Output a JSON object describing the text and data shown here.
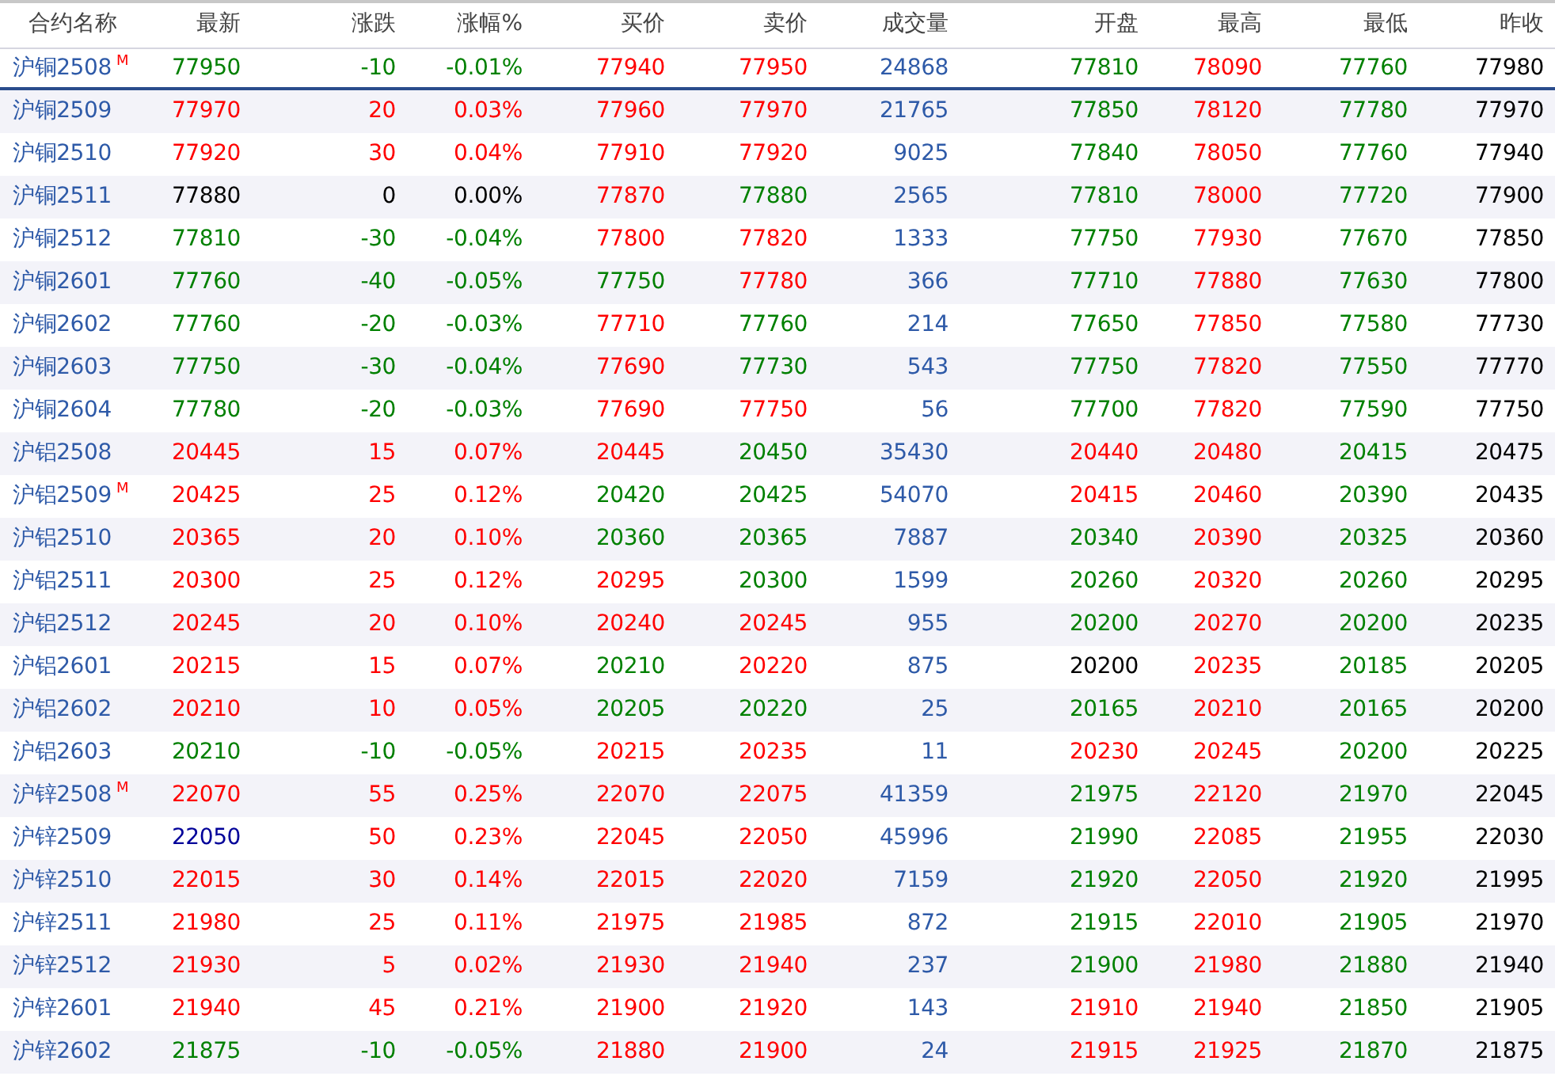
{
  "columns": [
    "合约名称",
    "最新",
    "涨跌",
    "涨幅%",
    "买价",
    "卖价",
    "成交量",
    "开盘",
    "最高",
    "最低",
    "昨收"
  ],
  "rows": [
    {
      "name": "沪铜2508",
      "mark": "M",
      "selected": true,
      "cells": [
        {
          "text": "77950",
          "color": "#008000"
        },
        {
          "text": "-10",
          "color": "#008000"
        },
        {
          "text": "-0.01%",
          "color": "#008000"
        },
        {
          "text": "77940",
          "color": "#ff0000"
        },
        {
          "text": "77950",
          "color": "#ff0000"
        },
        {
          "text": "24868",
          "color": "#2e5aa8"
        },
        {
          "text": "77810",
          "color": "#008000"
        },
        {
          "text": "78090",
          "color": "#ff0000"
        },
        {
          "text": "77760",
          "color": "#008000"
        },
        {
          "text": "77980",
          "color": "#000000"
        }
      ]
    },
    {
      "name": "沪铜2509",
      "selected": false,
      "cells": [
        {
          "text": "77970",
          "color": "#ff0000"
        },
        {
          "text": "20",
          "color": "#ff0000"
        },
        {
          "text": "0.03%",
          "color": "#ff0000"
        },
        {
          "text": "77960",
          "color": "#ff0000"
        },
        {
          "text": "77970",
          "color": "#ff0000"
        },
        {
          "text": "21765",
          "color": "#2e5aa8"
        },
        {
          "text": "77850",
          "color": "#008000"
        },
        {
          "text": "78120",
          "color": "#ff0000"
        },
        {
          "text": "77780",
          "color": "#008000"
        },
        {
          "text": "77970",
          "color": "#000000"
        }
      ]
    },
    {
      "name": "沪铜2510",
      "selected": false,
      "cells": [
        {
          "text": "77920",
          "color": "#ff0000"
        },
        {
          "text": "30",
          "color": "#ff0000"
        },
        {
          "text": "0.04%",
          "color": "#ff0000"
        },
        {
          "text": "77910",
          "color": "#ff0000"
        },
        {
          "text": "77920",
          "color": "#ff0000"
        },
        {
          "text": "9025",
          "color": "#2e5aa8"
        },
        {
          "text": "77840",
          "color": "#008000"
        },
        {
          "text": "78050",
          "color": "#ff0000"
        },
        {
          "text": "77760",
          "color": "#008000"
        },
        {
          "text": "77940",
          "color": "#000000"
        }
      ]
    },
    {
      "name": "沪铜2511",
      "selected": false,
      "cells": [
        {
          "text": "77880",
          "color": "#000000"
        },
        {
          "text": "0",
          "color": "#000000"
        },
        {
          "text": "0.00%",
          "color": "#000000"
        },
        {
          "text": "77870",
          "color": "#ff0000"
        },
        {
          "text": "77880",
          "color": "#008000"
        },
        {
          "text": "2565",
          "color": "#2e5aa8"
        },
        {
          "text": "77810",
          "color": "#008000"
        },
        {
          "text": "78000",
          "color": "#ff0000"
        },
        {
          "text": "77720",
          "color": "#008000"
        },
        {
          "text": "77900",
          "color": "#000000"
        }
      ]
    },
    {
      "name": "沪铜2512",
      "selected": false,
      "cells": [
        {
          "text": "77810",
          "color": "#008000"
        },
        {
          "text": "-30",
          "color": "#008000"
        },
        {
          "text": "-0.04%",
          "color": "#008000"
        },
        {
          "text": "77800",
          "color": "#ff0000"
        },
        {
          "text": "77820",
          "color": "#ff0000"
        },
        {
          "text": "1333",
          "color": "#2e5aa8"
        },
        {
          "text": "77750",
          "color": "#008000"
        },
        {
          "text": "77930",
          "color": "#ff0000"
        },
        {
          "text": "77670",
          "color": "#008000"
        },
        {
          "text": "77850",
          "color": "#000000"
        }
      ]
    },
    {
      "name": "沪铜2601",
      "selected": false,
      "cells": [
        {
          "text": "77760",
          "color": "#008000"
        },
        {
          "text": "-40",
          "color": "#008000"
        },
        {
          "text": "-0.05%",
          "color": "#008000"
        },
        {
          "text": "77750",
          "color": "#008000"
        },
        {
          "text": "77780",
          "color": "#ff0000"
        },
        {
          "text": "366",
          "color": "#2e5aa8"
        },
        {
          "text": "77710",
          "color": "#008000"
        },
        {
          "text": "77880",
          "color": "#ff0000"
        },
        {
          "text": "77630",
          "color": "#008000"
        },
        {
          "text": "77800",
          "color": "#000000"
        }
      ]
    },
    {
      "name": "沪铜2602",
      "selected": false,
      "cells": [
        {
          "text": "77760",
          "color": "#008000"
        },
        {
          "text": "-20",
          "color": "#008000"
        },
        {
          "text": "-0.03%",
          "color": "#008000"
        },
        {
          "text": "77710",
          "color": "#ff0000"
        },
        {
          "text": "77760",
          "color": "#008000"
        },
        {
          "text": "214",
          "color": "#2e5aa8"
        },
        {
          "text": "77650",
          "color": "#008000"
        },
        {
          "text": "77850",
          "color": "#ff0000"
        },
        {
          "text": "77580",
          "color": "#008000"
        },
        {
          "text": "77730",
          "color": "#000000"
        }
      ]
    },
    {
      "name": "沪铜2603",
      "selected": false,
      "cells": [
        {
          "text": "77750",
          "color": "#008000"
        },
        {
          "text": "-30",
          "color": "#008000"
        },
        {
          "text": "-0.04%",
          "color": "#008000"
        },
        {
          "text": "77690",
          "color": "#ff0000"
        },
        {
          "text": "77730",
          "color": "#008000"
        },
        {
          "text": "543",
          "color": "#2e5aa8"
        },
        {
          "text": "77750",
          "color": "#008000"
        },
        {
          "text": "77820",
          "color": "#ff0000"
        },
        {
          "text": "77550",
          "color": "#008000"
        },
        {
          "text": "77770",
          "color": "#000000"
        }
      ]
    },
    {
      "name": "沪铜2604",
      "selected": false,
      "cells": [
        {
          "text": "77780",
          "color": "#008000"
        },
        {
          "text": "-20",
          "color": "#008000"
        },
        {
          "text": "-0.03%",
          "color": "#008000"
        },
        {
          "text": "77690",
          "color": "#ff0000"
        },
        {
          "text": "77750",
          "color": "#ff0000"
        },
        {
          "text": "56",
          "color": "#2e5aa8"
        },
        {
          "text": "77700",
          "color": "#008000"
        },
        {
          "text": "77820",
          "color": "#ff0000"
        },
        {
          "text": "77590",
          "color": "#008000"
        },
        {
          "text": "77750",
          "color": "#000000"
        }
      ]
    },
    {
      "name": "沪铝2508",
      "selected": false,
      "cells": [
        {
          "text": "20445",
          "color": "#ff0000"
        },
        {
          "text": "15",
          "color": "#ff0000"
        },
        {
          "text": "0.07%",
          "color": "#ff0000"
        },
        {
          "text": "20445",
          "color": "#ff0000"
        },
        {
          "text": "20450",
          "color": "#008000"
        },
        {
          "text": "35430",
          "color": "#2e5aa8"
        },
        {
          "text": "20440",
          "color": "#ff0000"
        },
        {
          "text": "20480",
          "color": "#ff0000"
        },
        {
          "text": "20415",
          "color": "#008000"
        },
        {
          "text": "20475",
          "color": "#000000"
        }
      ]
    },
    {
      "name": "沪铝2509",
      "mark": "M",
      "selected": false,
      "cells": [
        {
          "text": "20425",
          "color": "#ff0000"
        },
        {
          "text": "25",
          "color": "#ff0000"
        },
        {
          "text": "0.12%",
          "color": "#ff0000"
        },
        {
          "text": "20420",
          "color": "#008000"
        },
        {
          "text": "20425",
          "color": "#008000"
        },
        {
          "text": "54070",
          "color": "#2e5aa8"
        },
        {
          "text": "20415",
          "color": "#ff0000"
        },
        {
          "text": "20460",
          "color": "#ff0000"
        },
        {
          "text": "20390",
          "color": "#008000"
        },
        {
          "text": "20435",
          "color": "#000000"
        }
      ]
    },
    {
      "name": "沪铝2510",
      "selected": false,
      "cells": [
        {
          "text": "20365",
          "color": "#ff0000"
        },
        {
          "text": "20",
          "color": "#ff0000"
        },
        {
          "text": "0.10%",
          "color": "#ff0000"
        },
        {
          "text": "20360",
          "color": "#008000"
        },
        {
          "text": "20365",
          "color": "#008000"
        },
        {
          "text": "7887",
          "color": "#2e5aa8"
        },
        {
          "text": "20340",
          "color": "#008000"
        },
        {
          "text": "20390",
          "color": "#ff0000"
        },
        {
          "text": "20325",
          "color": "#008000"
        },
        {
          "text": "20360",
          "color": "#000000"
        }
      ]
    },
    {
      "name": "沪铝2511",
      "selected": false,
      "cells": [
        {
          "text": "20300",
          "color": "#ff0000"
        },
        {
          "text": "25",
          "color": "#ff0000"
        },
        {
          "text": "0.12%",
          "color": "#ff0000"
        },
        {
          "text": "20295",
          "color": "#ff0000"
        },
        {
          "text": "20300",
          "color": "#008000"
        },
        {
          "text": "1599",
          "color": "#2e5aa8"
        },
        {
          "text": "20260",
          "color": "#008000"
        },
        {
          "text": "20320",
          "color": "#ff0000"
        },
        {
          "text": "20260",
          "color": "#008000"
        },
        {
          "text": "20295",
          "color": "#000000"
        }
      ]
    },
    {
      "name": "沪铝2512",
      "selected": false,
      "cells": [
        {
          "text": "20245",
          "color": "#ff0000"
        },
        {
          "text": "20",
          "color": "#ff0000"
        },
        {
          "text": "0.10%",
          "color": "#ff0000"
        },
        {
          "text": "20240",
          "color": "#ff0000"
        },
        {
          "text": "20245",
          "color": "#ff0000"
        },
        {
          "text": "955",
          "color": "#2e5aa8"
        },
        {
          "text": "20200",
          "color": "#008000"
        },
        {
          "text": "20270",
          "color": "#ff0000"
        },
        {
          "text": "20200",
          "color": "#008000"
        },
        {
          "text": "20235",
          "color": "#000000"
        }
      ]
    },
    {
      "name": "沪铝2601",
      "selected": false,
      "cells": [
        {
          "text": "20215",
          "color": "#ff0000"
        },
        {
          "text": "15",
          "color": "#ff0000"
        },
        {
          "text": "0.07%",
          "color": "#ff0000"
        },
        {
          "text": "20210",
          "color": "#008000"
        },
        {
          "text": "20220",
          "color": "#ff0000"
        },
        {
          "text": "875",
          "color": "#2e5aa8"
        },
        {
          "text": "20200",
          "color": "#000000"
        },
        {
          "text": "20235",
          "color": "#ff0000"
        },
        {
          "text": "20185",
          "color": "#008000"
        },
        {
          "text": "20205",
          "color": "#000000"
        }
      ]
    },
    {
      "name": "沪铝2602",
      "selected": false,
      "cells": [
        {
          "text": "20210",
          "color": "#ff0000"
        },
        {
          "text": "10",
          "color": "#ff0000"
        },
        {
          "text": "0.05%",
          "color": "#ff0000"
        },
        {
          "text": "20205",
          "color": "#008000"
        },
        {
          "text": "20220",
          "color": "#008000"
        },
        {
          "text": "25",
          "color": "#2e5aa8"
        },
        {
          "text": "20165",
          "color": "#008000"
        },
        {
          "text": "20210",
          "color": "#ff0000"
        },
        {
          "text": "20165",
          "color": "#008000"
        },
        {
          "text": "20200",
          "color": "#000000"
        }
      ]
    },
    {
      "name": "沪铝2603",
      "selected": false,
      "cells": [
        {
          "text": "20210",
          "color": "#008000"
        },
        {
          "text": "-10",
          "color": "#008000"
        },
        {
          "text": "-0.05%",
          "color": "#008000"
        },
        {
          "text": "20215",
          "color": "#ff0000"
        },
        {
          "text": "20235",
          "color": "#ff0000"
        },
        {
          "text": "11",
          "color": "#2e5aa8"
        },
        {
          "text": "20230",
          "color": "#ff0000"
        },
        {
          "text": "20245",
          "color": "#ff0000"
        },
        {
          "text": "20200",
          "color": "#008000"
        },
        {
          "text": "20225",
          "color": "#000000"
        }
      ]
    },
    {
      "name": "沪锌2508",
      "mark": "M",
      "selected": false,
      "cells": [
        {
          "text": "22070",
          "color": "#ff0000"
        },
        {
          "text": "55",
          "color": "#ff0000"
        },
        {
          "text": "0.25%",
          "color": "#ff0000"
        },
        {
          "text": "22070",
          "color": "#ff0000"
        },
        {
          "text": "22075",
          "color": "#ff0000"
        },
        {
          "text": "41359",
          "color": "#2e5aa8"
        },
        {
          "text": "21975",
          "color": "#008000"
        },
        {
          "text": "22120",
          "color": "#ff0000"
        },
        {
          "text": "21970",
          "color": "#008000"
        },
        {
          "text": "22045",
          "color": "#000000"
        }
      ]
    },
    {
      "name": "沪锌2509",
      "selected": false,
      "cells": [
        {
          "text": "22050",
          "color": "#000099"
        },
        {
          "text": "50",
          "color": "#ff0000"
        },
        {
          "text": "0.23%",
          "color": "#ff0000"
        },
        {
          "text": "22045",
          "color": "#ff0000"
        },
        {
          "text": "22050",
          "color": "#ff0000"
        },
        {
          "text": "45996",
          "color": "#2e5aa8"
        },
        {
          "text": "21990",
          "color": "#008000"
        },
        {
          "text": "22085",
          "color": "#ff0000"
        },
        {
          "text": "21955",
          "color": "#008000"
        },
        {
          "text": "22030",
          "color": "#000000"
        }
      ]
    },
    {
      "name": "沪锌2510",
      "selected": false,
      "cells": [
        {
          "text": "22015",
          "color": "#ff0000"
        },
        {
          "text": "30",
          "color": "#ff0000"
        },
        {
          "text": "0.14%",
          "color": "#ff0000"
        },
        {
          "text": "22015",
          "color": "#ff0000"
        },
        {
          "text": "22020",
          "color": "#ff0000"
        },
        {
          "text": "7159",
          "color": "#2e5aa8"
        },
        {
          "text": "21920",
          "color": "#008000"
        },
        {
          "text": "22050",
          "color": "#ff0000"
        },
        {
          "text": "21920",
          "color": "#008000"
        },
        {
          "text": "21995",
          "color": "#000000"
        }
      ]
    },
    {
      "name": "沪锌2511",
      "selected": false,
      "cells": [
        {
          "text": "21980",
          "color": "#ff0000"
        },
        {
          "text": "25",
          "color": "#ff0000"
        },
        {
          "text": "0.11%",
          "color": "#ff0000"
        },
        {
          "text": "21975",
          "color": "#ff0000"
        },
        {
          "text": "21985",
          "color": "#ff0000"
        },
        {
          "text": "872",
          "color": "#2e5aa8"
        },
        {
          "text": "21915",
          "color": "#008000"
        },
        {
          "text": "22010",
          "color": "#ff0000"
        },
        {
          "text": "21905",
          "color": "#008000"
        },
        {
          "text": "21970",
          "color": "#000000"
        }
      ]
    },
    {
      "name": "沪锌2512",
      "selected": false,
      "cells": [
        {
          "text": "21930",
          "color": "#ff0000"
        },
        {
          "text": "5",
          "color": "#ff0000"
        },
        {
          "text": "0.02%",
          "color": "#ff0000"
        },
        {
          "text": "21930",
          "color": "#ff0000"
        },
        {
          "text": "21940",
          "color": "#ff0000"
        },
        {
          "text": "237",
          "color": "#2e5aa8"
        },
        {
          "text": "21900",
          "color": "#008000"
        },
        {
          "text": "21980",
          "color": "#ff0000"
        },
        {
          "text": "21880",
          "color": "#008000"
        },
        {
          "text": "21940",
          "color": "#000000"
        }
      ]
    },
    {
      "name": "沪锌2601",
      "selected": false,
      "cells": [
        {
          "text": "21940",
          "color": "#ff0000"
        },
        {
          "text": "45",
          "color": "#ff0000"
        },
        {
          "text": "0.21%",
          "color": "#ff0000"
        },
        {
          "text": "21900",
          "color": "#ff0000"
        },
        {
          "text": "21920",
          "color": "#ff0000"
        },
        {
          "text": "143",
          "color": "#2e5aa8"
        },
        {
          "text": "21910",
          "color": "#ff0000"
        },
        {
          "text": "21940",
          "color": "#ff0000"
        },
        {
          "text": "21850",
          "color": "#008000"
        },
        {
          "text": "21905",
          "color": "#000000"
        }
      ]
    },
    {
      "name": "沪锌2602",
      "selected": false,
      "cells": [
        {
          "text": "21875",
          "color": "#008000"
        },
        {
          "text": "-10",
          "color": "#008000"
        },
        {
          "text": "-0.05%",
          "color": "#008000"
        },
        {
          "text": "21880",
          "color": "#ff0000"
        },
        {
          "text": "21900",
          "color": "#ff0000"
        },
        {
          "text": "24",
          "color": "#2e5aa8"
        },
        {
          "text": "21915",
          "color": "#ff0000"
        },
        {
          "text": "21925",
          "color": "#ff0000"
        },
        {
          "text": "21870",
          "color": "#008000"
        },
        {
          "text": "21875",
          "color": "#000000"
        }
      ]
    }
  ]
}
